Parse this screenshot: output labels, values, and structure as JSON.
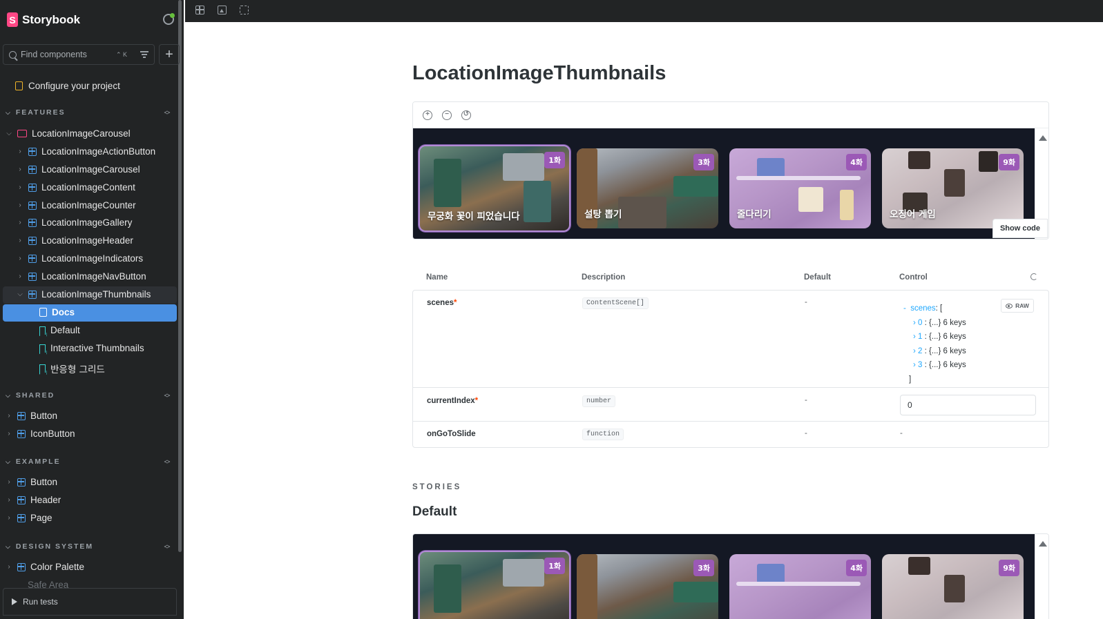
{
  "sidebar": {
    "brand": "Storybook",
    "search": {
      "placeholder": "Find components",
      "shortcut": "⌃ K"
    },
    "configure": "Configure your project",
    "sections": {
      "features": "FEATURES",
      "shared": "SHARED",
      "example": "EXAMPLE",
      "design_system": "DESIGN SYSTEM"
    },
    "features_group": "LocationImageCarousel",
    "features_items": [
      "LocationImageActionButton",
      "LocationImageCarousel",
      "LocationImageContent",
      "LocationImageCounter",
      "LocationImageGallery",
      "LocationImageHeader",
      "LocationImageIndicators",
      "LocationImageNavButton",
      "LocationImageThumbnails"
    ],
    "thumbnails_children": [
      "Docs",
      "Default",
      "Interactive Thumbnails",
      "반응형 그리드"
    ],
    "shared_items": [
      "Button",
      "IconButton"
    ],
    "example_items": [
      "Button",
      "Header",
      "Page"
    ],
    "design_items": [
      "Color Palette",
      "Safe Area"
    ],
    "run_tests": "Run tests"
  },
  "main": {
    "title": "LocationImageThumbnails",
    "show_code": "Show code",
    "thumbnails": [
      {
        "title": "무궁화 꽃이 피었습니다",
        "badge": "1화",
        "selected": true
      },
      {
        "title": "설탕 뽑기",
        "badge": "3화",
        "selected": false
      },
      {
        "title": "줄다리기",
        "badge": "4화",
        "selected": false
      },
      {
        "title": "오징어 게임",
        "badge": "9화",
        "selected": false
      }
    ],
    "args_table": {
      "headers": [
        "Name",
        "Description",
        "Default",
        "Control"
      ],
      "rows": [
        {
          "name": "scenes",
          "required": "*",
          "type": "ContentScene[]",
          "default": "-"
        },
        {
          "name": "currentIndex",
          "required": "*",
          "type": "number",
          "default": "-",
          "control_value": "0"
        },
        {
          "name": "onGoToSlide",
          "required": "",
          "type": "function",
          "default": "-",
          "control_value": "-"
        }
      ],
      "scenes_tree": {
        "dash": "-",
        "key": "scenes",
        "open": ":  [",
        "entries": [
          {
            "index": "0",
            "summary": ": {...} 6 keys"
          },
          {
            "index": "1",
            "summary": ": {...} 6 keys"
          },
          {
            "index": "2",
            "summary": ": {...} 6 keys"
          },
          {
            "index": "3",
            "summary": ": {...} 6 keys"
          }
        ],
        "close": "]",
        "raw_label": "RAW"
      }
    },
    "stories_label": "STORIES",
    "story_title": "Default"
  },
  "colors": {
    "sidebar_bg": "#222425",
    "accent": "#4a90e2",
    "brand": "#ff4785",
    "badge": "#9b59b6",
    "stage_bg": "#141824"
  }
}
